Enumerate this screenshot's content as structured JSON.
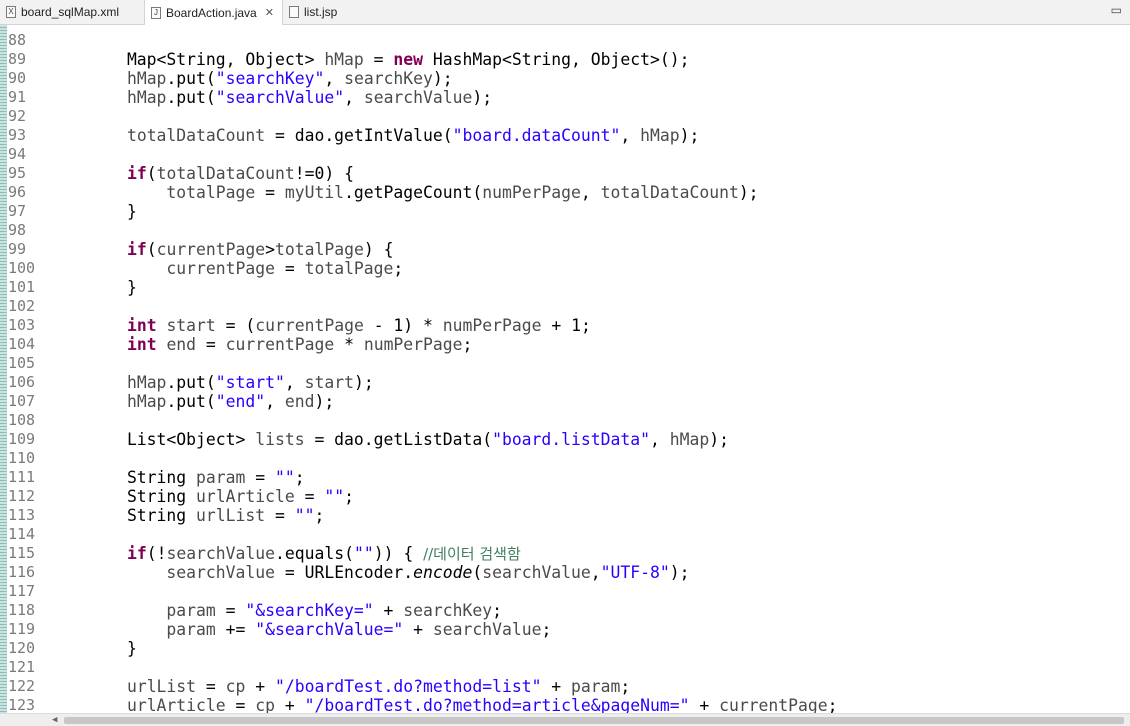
{
  "tabs": [
    {
      "label": "board_sqlMap.xml",
      "icon": "xml-file-icon",
      "glyph": "X",
      "active": false
    },
    {
      "label": "BoardAction.java",
      "icon": "java-file-icon",
      "glyph": "J",
      "active": true
    },
    {
      "label": "list.jsp",
      "icon": "jsp-file-icon",
      "glyph": "",
      "active": false
    }
  ],
  "tab_close_glyph": "✕",
  "maximize_glyph": "▭",
  "line_numbers": [
    "88",
    "89",
    "90",
    "91",
    "92",
    "93",
    "94",
    "95",
    "96",
    "97",
    "98",
    "99",
    "100",
    "101",
    "102",
    "103",
    "104",
    "105",
    "106",
    "107",
    "108",
    "109",
    "110",
    "111",
    "112",
    "113",
    "114",
    "115",
    "116",
    "117",
    "118",
    "119",
    "120",
    "121",
    "122",
    "123"
  ],
  "code_lines": [
    [],
    [
      {
        "t": "        Map<String, Object> "
      },
      {
        "t": "hMap",
        "c": "var"
      },
      {
        "t": " = "
      },
      {
        "t": "new",
        "c": "kw"
      },
      {
        "t": " HashMap<String, Object>();"
      }
    ],
    [
      {
        "t": "        "
      },
      {
        "t": "hMap",
        "c": "var"
      },
      {
        "t": ".put("
      },
      {
        "t": "\"searchKey\"",
        "c": "str"
      },
      {
        "t": ", "
      },
      {
        "t": "searchKey",
        "c": "var"
      },
      {
        "t": ");"
      }
    ],
    [
      {
        "t": "        "
      },
      {
        "t": "hMap",
        "c": "var"
      },
      {
        "t": ".put("
      },
      {
        "t": "\"searchValue\"",
        "c": "str"
      },
      {
        "t": ", "
      },
      {
        "t": "searchValue",
        "c": "var"
      },
      {
        "t": ");"
      }
    ],
    [],
    [
      {
        "t": "        "
      },
      {
        "t": "totalDataCount",
        "c": "var"
      },
      {
        "t": " = dao.getIntValue("
      },
      {
        "t": "\"board.dataCount\"",
        "c": "str"
      },
      {
        "t": ", "
      },
      {
        "t": "hMap",
        "c": "var"
      },
      {
        "t": ");"
      }
    ],
    [],
    [
      {
        "t": "        "
      },
      {
        "t": "if",
        "c": "kw"
      },
      {
        "t": "("
      },
      {
        "t": "totalDataCount",
        "c": "var"
      },
      {
        "t": "!=0) {"
      }
    ],
    [
      {
        "t": "            "
      },
      {
        "t": "totalPage",
        "c": "var"
      },
      {
        "t": " = "
      },
      {
        "t": "myUtil",
        "c": "var"
      },
      {
        "t": ".getPageCount("
      },
      {
        "t": "numPerPage",
        "c": "var"
      },
      {
        "t": ", "
      },
      {
        "t": "totalDataCount",
        "c": "var"
      },
      {
        "t": ");"
      }
    ],
    [
      {
        "t": "        }"
      }
    ],
    [],
    [
      {
        "t": "        "
      },
      {
        "t": "if",
        "c": "kw"
      },
      {
        "t": "("
      },
      {
        "t": "currentPage",
        "c": "var"
      },
      {
        "t": ">"
      },
      {
        "t": "totalPage",
        "c": "var"
      },
      {
        "t": ") {"
      }
    ],
    [
      {
        "t": "            "
      },
      {
        "t": "currentPage",
        "c": "var"
      },
      {
        "t": " = "
      },
      {
        "t": "totalPage",
        "c": "var"
      },
      {
        "t": ";"
      }
    ],
    [
      {
        "t": "        }"
      }
    ],
    [],
    [
      {
        "t": "        "
      },
      {
        "t": "int",
        "c": "kw"
      },
      {
        "t": " "
      },
      {
        "t": "start",
        "c": "var"
      },
      {
        "t": " = ("
      },
      {
        "t": "currentPage",
        "c": "var"
      },
      {
        "t": " - 1) * "
      },
      {
        "t": "numPerPage",
        "c": "var"
      },
      {
        "t": " + 1;"
      }
    ],
    [
      {
        "t": "        "
      },
      {
        "t": "int",
        "c": "kw"
      },
      {
        "t": " "
      },
      {
        "t": "end",
        "c": "var"
      },
      {
        "t": " = "
      },
      {
        "t": "currentPage",
        "c": "var"
      },
      {
        "t": " * "
      },
      {
        "t": "numPerPage",
        "c": "var"
      },
      {
        "t": ";"
      }
    ],
    [],
    [
      {
        "t": "        "
      },
      {
        "t": "hMap",
        "c": "var"
      },
      {
        "t": ".put("
      },
      {
        "t": "\"start\"",
        "c": "str"
      },
      {
        "t": ", "
      },
      {
        "t": "start",
        "c": "var"
      },
      {
        "t": ");"
      }
    ],
    [
      {
        "t": "        "
      },
      {
        "t": "hMap",
        "c": "var"
      },
      {
        "t": ".put("
      },
      {
        "t": "\"end\"",
        "c": "str"
      },
      {
        "t": ", "
      },
      {
        "t": "end",
        "c": "var"
      },
      {
        "t": ");"
      }
    ],
    [],
    [
      {
        "t": "        List<Object> "
      },
      {
        "t": "lists",
        "c": "var"
      },
      {
        "t": " = dao.getListData("
      },
      {
        "t": "\"board.listData\"",
        "c": "str"
      },
      {
        "t": ", "
      },
      {
        "t": "hMap",
        "c": "var"
      },
      {
        "t": ");"
      }
    ],
    [],
    [
      {
        "t": "        String "
      },
      {
        "t": "param",
        "c": "var"
      },
      {
        "t": " = "
      },
      {
        "t": "\"\"",
        "c": "str"
      },
      {
        "t": ";"
      }
    ],
    [
      {
        "t": "        String "
      },
      {
        "t": "urlArticle",
        "c": "var"
      },
      {
        "t": " = "
      },
      {
        "t": "\"\"",
        "c": "str"
      },
      {
        "t": ";"
      }
    ],
    [
      {
        "t": "        String "
      },
      {
        "t": "urlList",
        "c": "var"
      },
      {
        "t": " = "
      },
      {
        "t": "\"\"",
        "c": "str"
      },
      {
        "t": ";"
      }
    ],
    [],
    [
      {
        "t": "        "
      },
      {
        "t": "if",
        "c": "kw"
      },
      {
        "t": "(!"
      },
      {
        "t": "searchValue",
        "c": "var"
      },
      {
        "t": ".equals("
      },
      {
        "t": "\"\"",
        "c": "str"
      },
      {
        "t": ")) { "
      },
      {
        "t": "//데이터 검색함",
        "c": "cmt"
      }
    ],
    [
      {
        "t": "            "
      },
      {
        "t": "searchValue",
        "c": "var"
      },
      {
        "t": " = URLEncoder."
      },
      {
        "t": "encode",
        "c": "it"
      },
      {
        "t": "("
      },
      {
        "t": "searchValue",
        "c": "var"
      },
      {
        "t": ","
      },
      {
        "t": "\"UTF-8\"",
        "c": "str"
      },
      {
        "t": ");"
      }
    ],
    [],
    [
      {
        "t": "            "
      },
      {
        "t": "param",
        "c": "var"
      },
      {
        "t": " = "
      },
      {
        "t": "\"&searchKey=\"",
        "c": "str"
      },
      {
        "t": " + "
      },
      {
        "t": "searchKey",
        "c": "var"
      },
      {
        "t": ";"
      }
    ],
    [
      {
        "t": "            "
      },
      {
        "t": "param",
        "c": "var"
      },
      {
        "t": " += "
      },
      {
        "t": "\"&searchValue=\"",
        "c": "str"
      },
      {
        "t": " + "
      },
      {
        "t": "searchValue",
        "c": "var"
      },
      {
        "t": ";"
      }
    ],
    [
      {
        "t": "        }"
      }
    ],
    [],
    [
      {
        "t": "        "
      },
      {
        "t": "urlList",
        "c": "var"
      },
      {
        "t": " = "
      },
      {
        "t": "cp",
        "c": "var"
      },
      {
        "t": " + "
      },
      {
        "t": "\"/boardTest.do?method=list\"",
        "c": "str"
      },
      {
        "t": " + "
      },
      {
        "t": "param",
        "c": "var"
      },
      {
        "t": ";"
      }
    ],
    [
      {
        "t": "        "
      },
      {
        "t": "urlArticle",
        "c": "var"
      },
      {
        "t": " = "
      },
      {
        "t": "cp",
        "c": "var"
      },
      {
        "t": " + "
      },
      {
        "t": "\"/boardTest.do?method=article&pageNum=\"",
        "c": "str"
      },
      {
        "t": " + "
      },
      {
        "t": "currentPage",
        "c": "var"
      },
      {
        "t": ";"
      }
    ]
  ],
  "scroll_left_glyph": "◀"
}
